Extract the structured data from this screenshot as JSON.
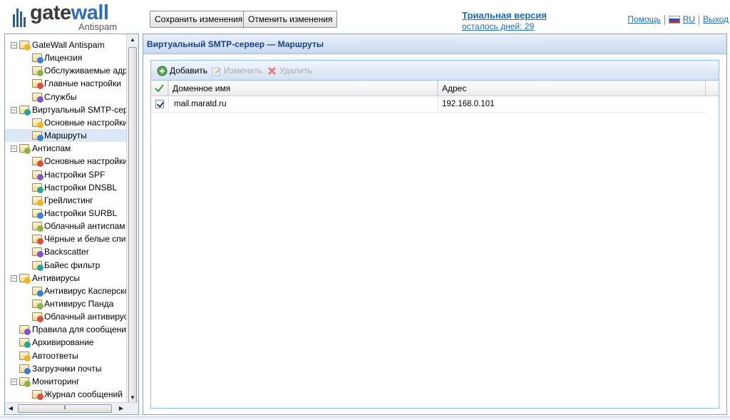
{
  "logo": {
    "word_gate": "gate",
    "word_wall": "wall",
    "sub": "Antispam"
  },
  "toolbar": {
    "save_label": "Сохранить изменения",
    "cancel_label": "Отменить изменения"
  },
  "trial": {
    "title": "Триальная версия",
    "days": "осталось дней: 29"
  },
  "toplinks": {
    "help": "Помощь",
    "lang": "RU",
    "logout": "Выход"
  },
  "sidebar": {
    "items": [
      {
        "label": "GateWall Antispam",
        "icon": "gatewall-icon"
      },
      {
        "label": "Лицензия",
        "icon": "info-icon"
      },
      {
        "label": "Обслуживаемые адреса",
        "icon": "mail-addresses-icon"
      },
      {
        "label": "Главные настройки",
        "icon": "settings-icon"
      },
      {
        "label": "Службы",
        "icon": "services-icon"
      },
      {
        "label": "Виртуальный SMTP-сервер",
        "icon": "at-icon"
      },
      {
        "label": "Основные настройки",
        "icon": "at-settings-icon"
      },
      {
        "label": "Маршруты",
        "icon": "routes-icon"
      },
      {
        "label": "Антиспам",
        "icon": "antispam-icon"
      },
      {
        "label": "Основные настройки",
        "icon": "mail-settings-icon"
      },
      {
        "label": "Настройки SPF",
        "icon": "spf-icon"
      },
      {
        "label": "Настройки DNSBL",
        "icon": "dnsbl-icon"
      },
      {
        "label": "Грейлистинг",
        "icon": "greylist-icon"
      },
      {
        "label": "Настройки SURBL",
        "icon": "surbl-icon"
      },
      {
        "label": "Облачный антиспам",
        "icon": "cloud-antispam-icon"
      },
      {
        "label": "Чёрные и белые списки",
        "icon": "lists-icon"
      },
      {
        "label": "Backscatter",
        "icon": "backscatter-icon"
      },
      {
        "label": "Байес фильтр",
        "icon": "bayes-icon"
      },
      {
        "label": "Антивирусы",
        "icon": "antivirus-icon"
      },
      {
        "label": "Антивирус Касперского",
        "icon": "kaspersky-icon"
      },
      {
        "label": "Антивирус Панда",
        "icon": "panda-icon"
      },
      {
        "label": "Облачный антивирус",
        "icon": "cloud-antivirus-icon"
      },
      {
        "label": "Правила для сообщений",
        "icon": "rules-icon"
      },
      {
        "label": "Архивирование",
        "icon": "archive-icon"
      },
      {
        "label": "Автоответы",
        "icon": "autoreply-icon"
      },
      {
        "label": "Загрузчики почты",
        "icon": "mail-loader-icon"
      },
      {
        "label": "Мониторинг",
        "icon": "monitoring-icon"
      },
      {
        "label": "Журнал сообщений",
        "icon": "log-icon"
      }
    ]
  },
  "main": {
    "title": "Виртуальный SMTP-сервер — Маршруты",
    "toolbar": {
      "add": "Добавить",
      "edit": "Изменить",
      "delete": "Удалить"
    },
    "columns": [
      "Доменное имя",
      "Адрес"
    ],
    "rows": [
      {
        "checked": true,
        "domain": "mail.maratd.ru",
        "address": "192.168.0.101"
      }
    ]
  },
  "colors": {
    "accent": "#1a6dbd",
    "panel_title": "#15428b",
    "panel_border": "#99bbe8"
  }
}
